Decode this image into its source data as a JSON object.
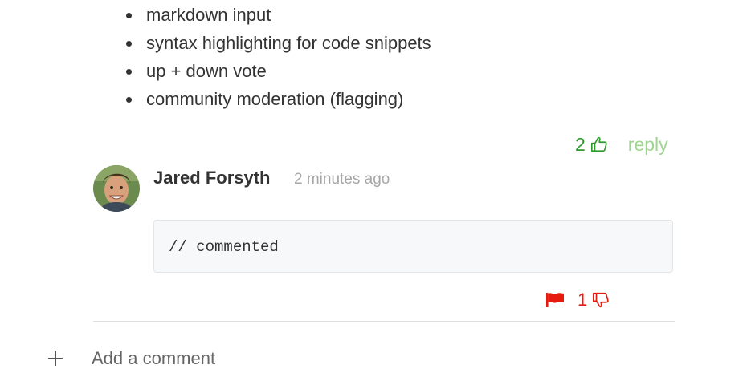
{
  "features": {
    "items": [
      "markdown input",
      "syntax highlighting for code snippets",
      "up + down vote",
      "community moderation (flagging)"
    ]
  },
  "top_actions": {
    "upvote_count": "2",
    "reply_label": "reply"
  },
  "comment": {
    "author": "Jared Forsyth",
    "timestamp": "2 minutes ago",
    "code": "// commented",
    "downvote_count": "1"
  },
  "composer": {
    "add_comment_label": "Add a comment"
  },
  "colors": {
    "upvote": "#2e9a2e",
    "reply": "#9ed68f",
    "flag_downvote": "#e8190f"
  },
  "icons": {
    "upvote": "thumbs-up-icon",
    "downvote": "thumbs-down-icon",
    "flag": "flag-icon",
    "add": "plus-icon"
  }
}
